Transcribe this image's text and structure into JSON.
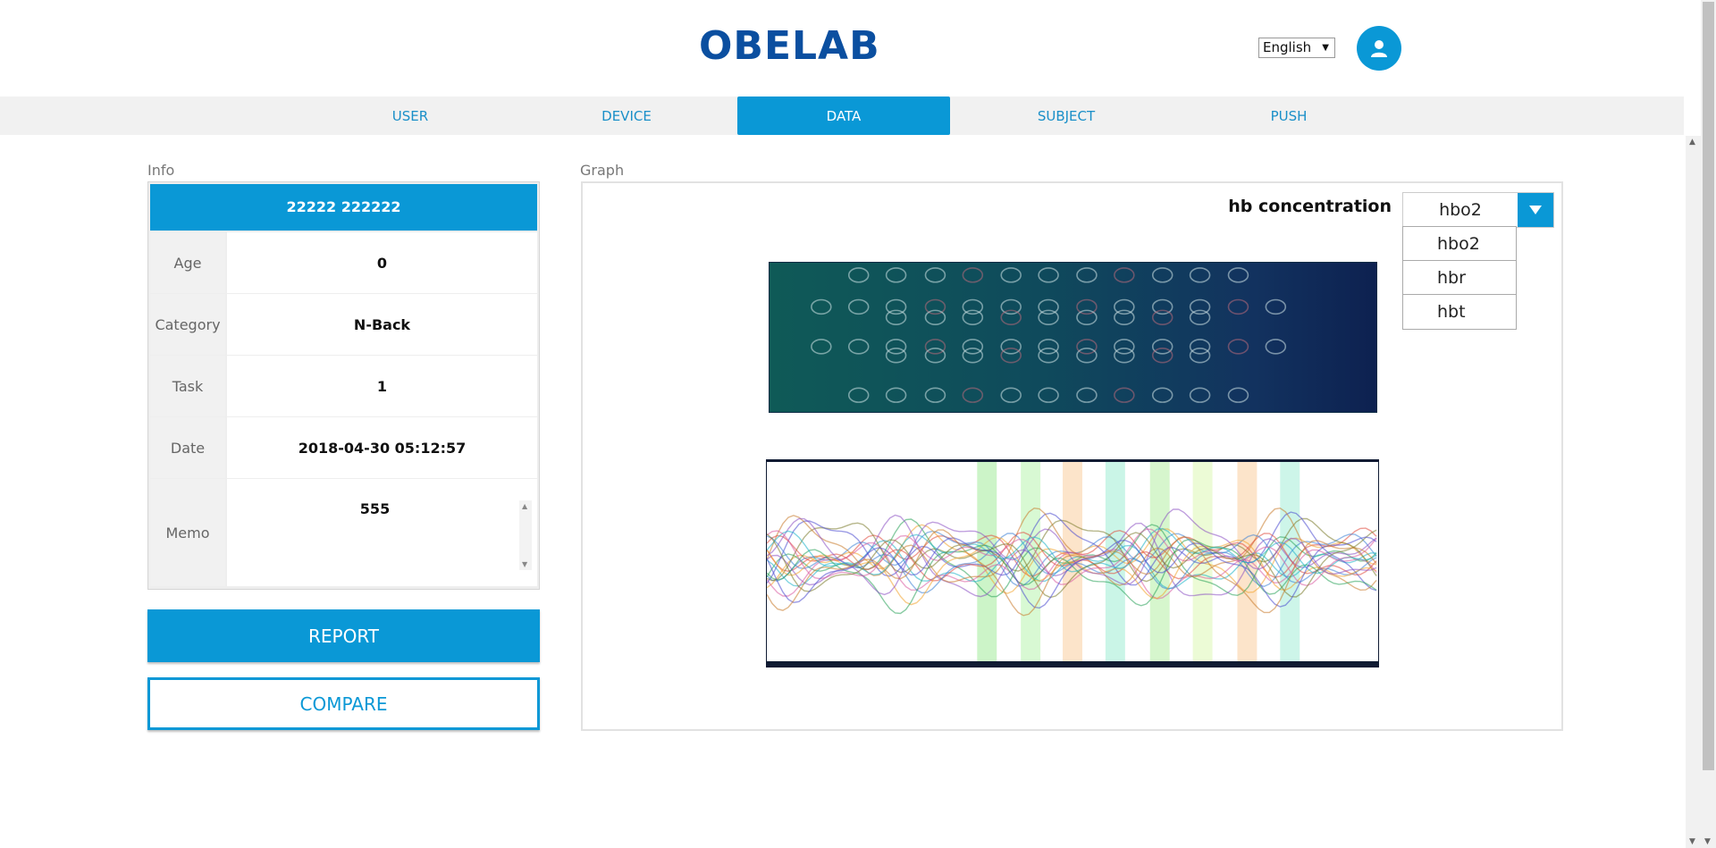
{
  "header": {
    "logo_text": "OBELAB",
    "language": "English",
    "language_arrow": "▼"
  },
  "nav": {
    "tabs": [
      {
        "label": "USER",
        "active": false
      },
      {
        "label": "DEVICE",
        "active": false
      },
      {
        "label": "DATA",
        "active": true
      },
      {
        "label": "SUBJECT",
        "active": false
      },
      {
        "label": "PUSH",
        "active": false
      }
    ]
  },
  "info": {
    "section_label": "Info",
    "subject_name": "22222 222222",
    "rows": [
      {
        "key": "Age",
        "value": "0"
      },
      {
        "key": "Category",
        "value": "N-Back"
      },
      {
        "key": "Task",
        "value": "1"
      },
      {
        "key": "Date",
        "value": "2018-04-30 05:12:57"
      }
    ],
    "memo_label": "Memo",
    "memo_value": "555"
  },
  "actions": {
    "report_label": "REPORT",
    "compare_label": "COMPARE"
  },
  "graph": {
    "section_label": "Graph",
    "hb_label": "hb concentration",
    "hb_selected": "hbo2",
    "hb_options": [
      "hbo2",
      "hbr",
      "hbt"
    ]
  },
  "colors": {
    "accent": "#0a98d6",
    "logo": "#0b4fa0",
    "nav_bg": "#f1f1f1"
  },
  "icons": {
    "avatar": "user-icon",
    "hb_dropdown": "caret-down-icon"
  }
}
